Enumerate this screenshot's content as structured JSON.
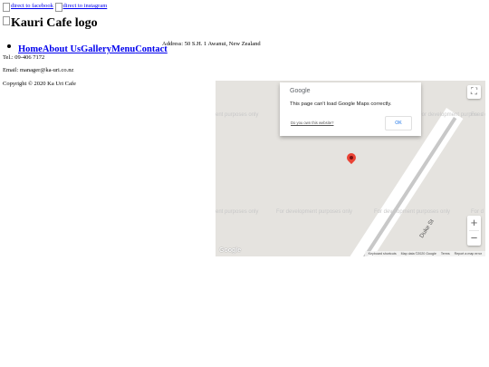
{
  "header": {
    "facebook_link": "direct to facebook",
    "instagram_link": "direct to instagram",
    "logo_alt": "Kauri Cafe logo"
  },
  "nav": {
    "items": [
      {
        "label": "Home"
      },
      {
        "label": "About Us"
      },
      {
        "label": "Gallery"
      },
      {
        "label": "Menu"
      },
      {
        "label": "Contact"
      }
    ]
  },
  "contact": {
    "address": "Address: 50 S.H. 1 Awanui, New Zealand",
    "phone": "Tel.: 09-406 7172",
    "email": "Email: manager@ka-uri.co.nz",
    "copyright": "Copyright © 2020 Ka Uri Cafe"
  },
  "map": {
    "dialog": {
      "logo": "Google",
      "message": "This page can't load Google Maps correctly.",
      "owner_link": "Do you own this website?",
      "ok_button": "OK"
    },
    "watermark": "For development purposes only",
    "watermark_left_fragment": "ent purposes only",
    "watermark_right_fragment": "For d",
    "street_label": "Duke St",
    "zoom_in": "+",
    "zoom_out": "−",
    "google_logo": "Google",
    "attribution": {
      "shortcuts": "Keyboard shortcuts",
      "data": "Map data ©2020 Google",
      "terms": "Terms",
      "report": "Report a map error"
    },
    "colors": {
      "background": "#e5e3df",
      "pin": "#ea4335",
      "ok_text": "#1a73e8"
    }
  }
}
